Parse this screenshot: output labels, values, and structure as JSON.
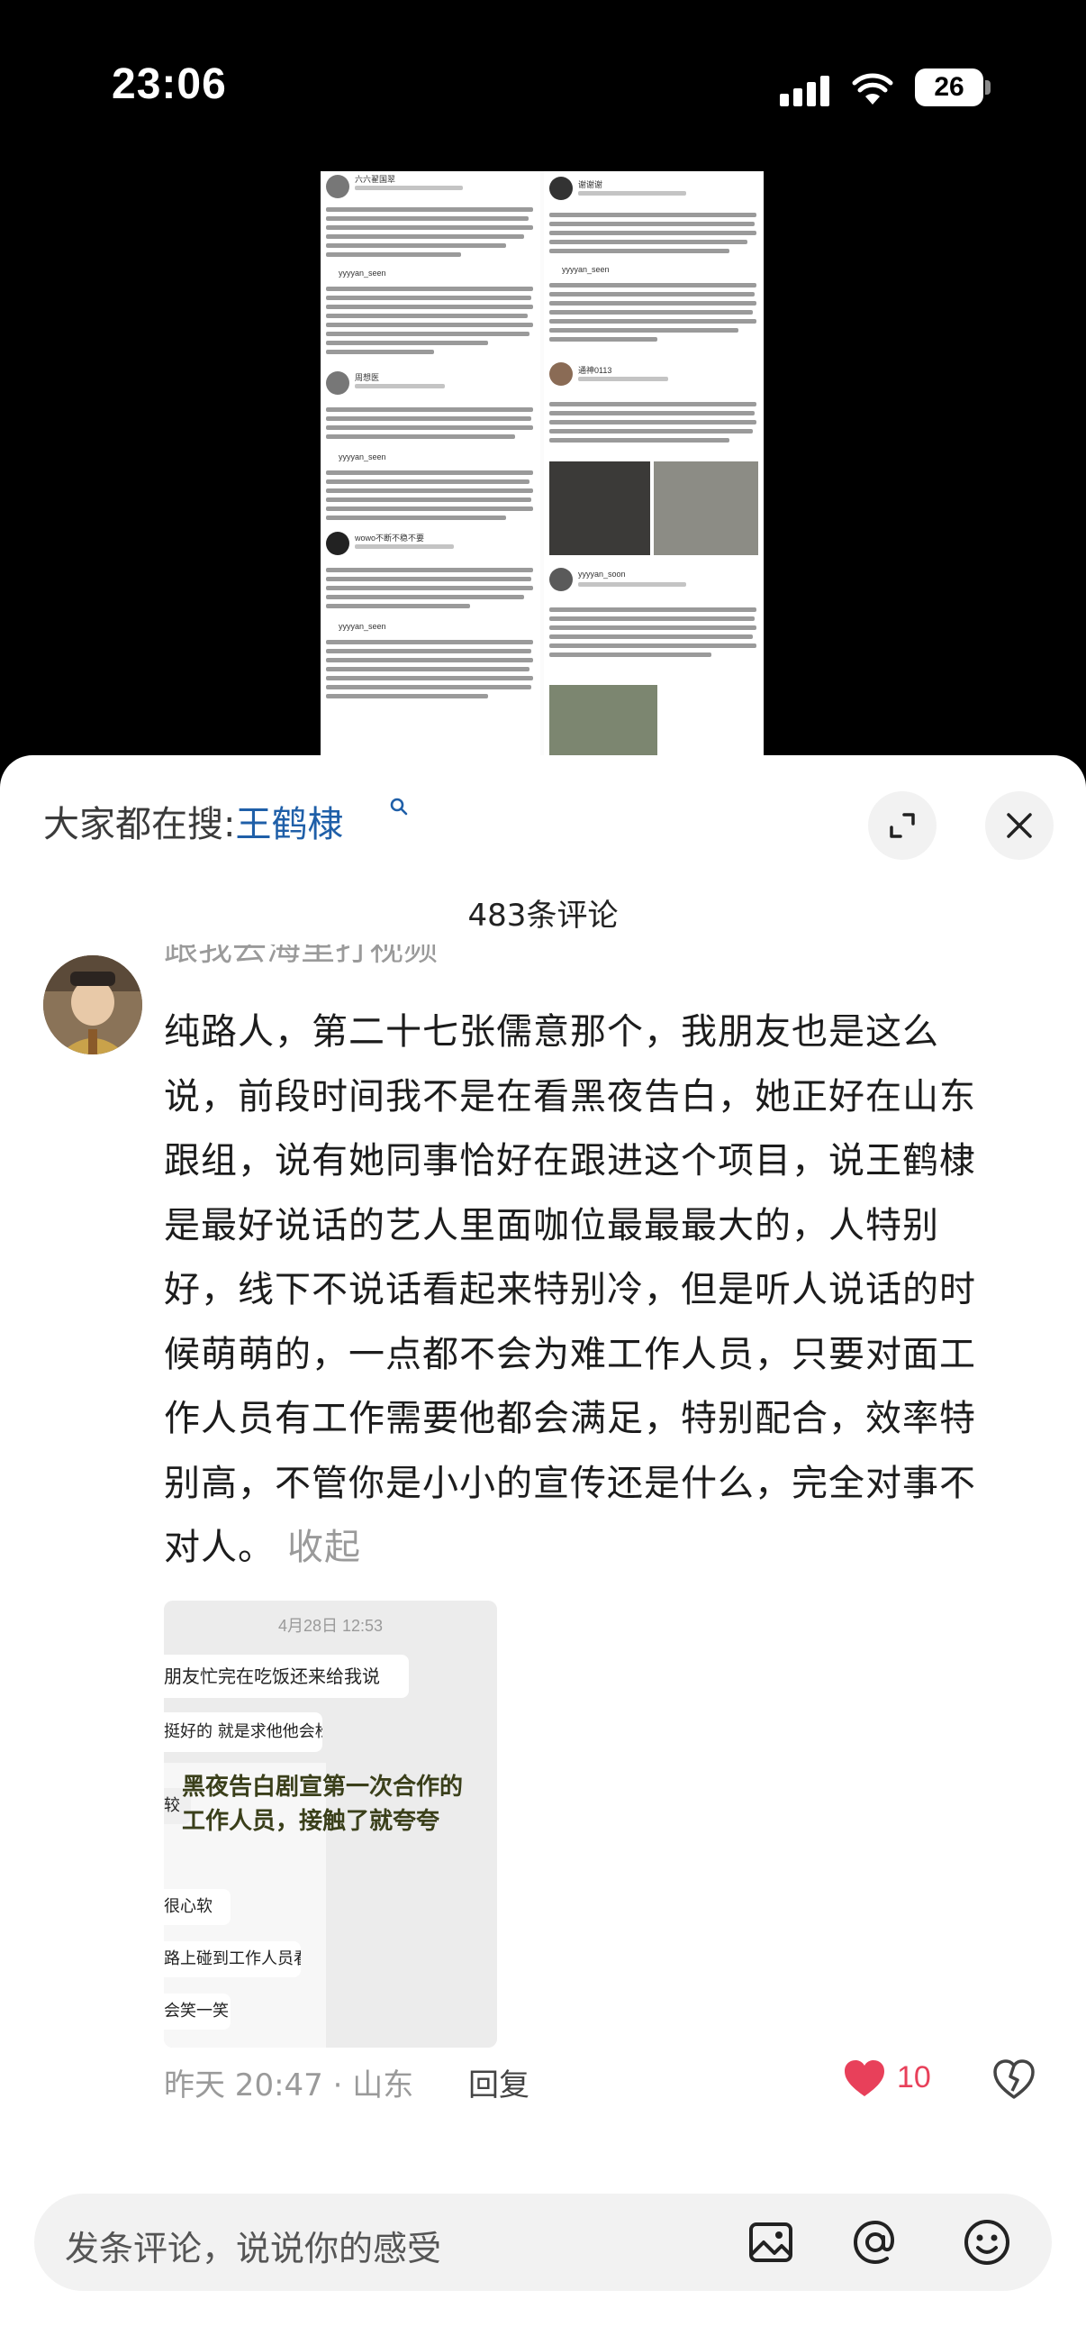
{
  "status_bar": {
    "time": "23:06",
    "battery": "26"
  },
  "post_preview": {
    "usernames": [
      "六六翟国翠",
      "yyyyan_seen",
      "周想医",
      "yyyyan_seen",
      "wowo不断不稳不要",
      "yyyyan_seen",
      "谢谢谢",
      "yyyyan_seen",
      "通神0113",
      "yyyyan_soon"
    ]
  },
  "sheet": {
    "search_hint_prefix": "大家都在搜:",
    "search_hint_term": "王鹤棣",
    "comment_count": "483条评论",
    "previous_username_fragment": "跟我去海里打视频",
    "comment": {
      "lines": [
        "纯路人，第二十七张儒意那个，我朋友也是这么",
        "说，前段时间我不是在看黑夜告白，她正好在山东",
        "跟组，说有她同事恰好在跟进这个项目，说王鹤棣",
        "是最好说话的艺人里面咖位最最最大的，人特别",
        "好，线下不说话看起来特别冷，但是听人说话的时",
        "候萌萌的，一点都不会为难工作人员，只要对面工",
        "作人员有工作需要他都会满足，特别配合，效率特",
        "别高，不管你是小小的宣传还是什么，完全对事不"
      ],
      "last_line": "对人。",
      "collapse_label": "收起",
      "image": {
        "time": "4月28日 12:53",
        "bubbles": [
          "朋友忙完在吃饭还来给我说",
          "挺好的 就是求他他会松口",
          "较",
          "很心软",
          "路上碰到工作人员看他",
          "会笑一笑"
        ],
        "overlay_lines": [
          "黑夜告白剧宣第一次合作的",
          "工作人员，接触了就夸夸"
        ]
      },
      "meta": "昨天 20:47 · 山东",
      "reply_label": "回复",
      "like_count": "10"
    },
    "input": {
      "placeholder": "发条评论，说说你的感受"
    }
  },
  "icons": {
    "expand": "expand-icon",
    "close": "close-icon",
    "search": "search-icon",
    "like": "heart-filled-icon",
    "dislike": "heart-broken-icon",
    "image": "image-icon",
    "at": "at-icon",
    "emoji": "emoji-icon"
  },
  "colors": {
    "accent_blue": "#1f5fa8",
    "like_red": "#e8405a",
    "meta_grey": "#9a9a9a"
  }
}
